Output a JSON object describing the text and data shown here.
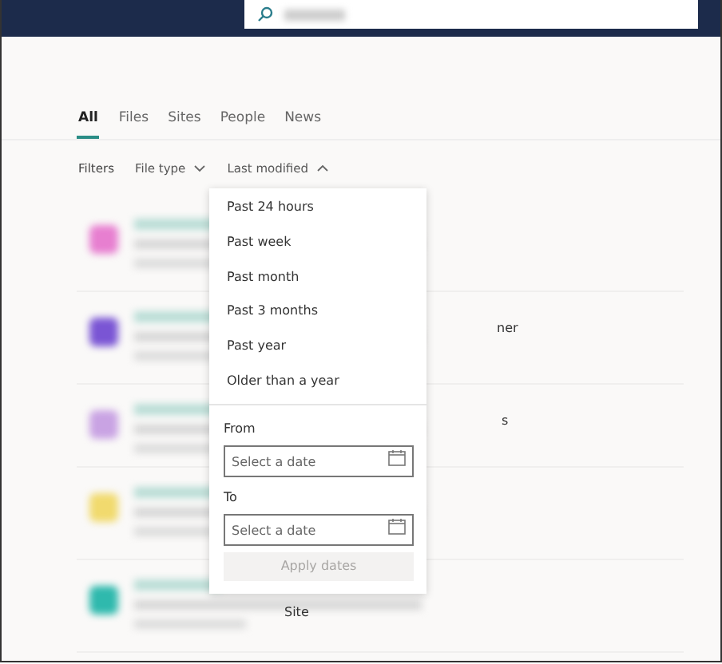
{
  "tabs": [
    {
      "label": "All",
      "selected": true
    },
    {
      "label": "Files",
      "selected": false
    },
    {
      "label": "Sites",
      "selected": false
    },
    {
      "label": "People",
      "selected": false
    },
    {
      "label": "News",
      "selected": false
    }
  ],
  "filters": {
    "label": "Filters",
    "dropdowns": [
      {
        "label": "File type",
        "expanded": false
      },
      {
        "label": "Last modified",
        "expanded": true
      }
    ]
  },
  "results": [
    {
      "color": "#e77fd0"
    },
    {
      "color": "#7a55d4",
      "fragment": "ner"
    },
    {
      "color": "#c9a3e3",
      "fragment": "s"
    },
    {
      "color": "#f1da6e"
    },
    {
      "color": "#2fb9ad",
      "fragment": "Site"
    }
  ],
  "menu": {
    "options": [
      "Past 24 hours",
      "Past week",
      "Past month",
      "Past 3 months",
      "Past year",
      "Older than a year"
    ],
    "from": {
      "label": "From",
      "placeholder": "Select a date"
    },
    "to": {
      "label": "To",
      "placeholder": "Select a date"
    },
    "apply": {
      "label": "Apply dates",
      "disabled": true
    }
  }
}
